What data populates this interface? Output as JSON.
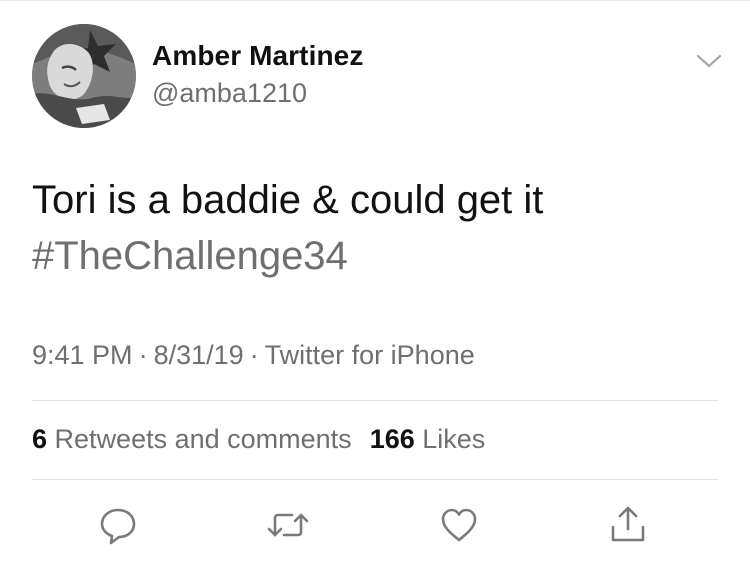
{
  "tweet": {
    "author": {
      "display_name": "Amber Martinez",
      "handle": "@amba1210",
      "avatar_icon": "profile-photo"
    },
    "menu_icon": "chevron-down-icon",
    "text": "Tori is a baddie & could get it",
    "hashtag": "#TheChallenge34",
    "time": "9:41 PM",
    "date": "8/31/19",
    "source": "Twitter for iPhone",
    "separator": "·",
    "stats": {
      "retweets_count": "6",
      "retweets_label": "Retweets and comments",
      "likes_count": "166",
      "likes_label": "Likes"
    },
    "actions": [
      {
        "name": "reply",
        "icon": "speech-bubble-icon"
      },
      {
        "name": "retweet",
        "icon": "retweet-arrows-icon"
      },
      {
        "name": "like",
        "icon": "heart-icon"
      },
      {
        "name": "share",
        "icon": "share-upload-icon"
      }
    ]
  },
  "colors": {
    "text_primary": "#111111",
    "text_secondary": "#6f6f6f",
    "divider": "#e3e3e3",
    "background": "#ffffff"
  }
}
